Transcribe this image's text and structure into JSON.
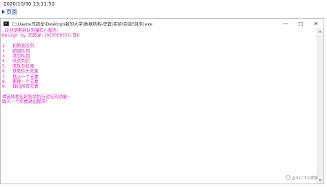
{
  "document": {
    "timestamp": "2020/10/30 13:11:50",
    "link_text": "页面"
  },
  "window": {
    "title": "C:\\Users\\司超龙\\Desktop\\我的大学\\数据结构-史蓉\\实验\\实验5队列.exe",
    "controls": {
      "minimize": "—",
      "maximize": "□",
      "close": "✕"
    }
  },
  "console": {
    "welcome": "☆欢迎使用链队列操作小程序☆",
    "credit": "Design by 司超龙-1925050351-软6",
    "menu": [
      "1.  初始化队列",
      "2.  销毁队列",
      "3.  清空队列",
      "4.  队列判空",
      "5.  求队列长度",
      "6.  获取队头元素",
      "7.  插入一个元素",
      "8.  删除一个元素",
      "9.  输出所有元素"
    ],
    "prompt": "请选择相应的指令执行对应的功能~",
    "hint": "输入一个负数退出程序!"
  },
  "watermark": {
    "text": "@51CTO博客"
  },
  "colors": {
    "console_text": "#e020c0",
    "link": "#1a3fbf"
  }
}
